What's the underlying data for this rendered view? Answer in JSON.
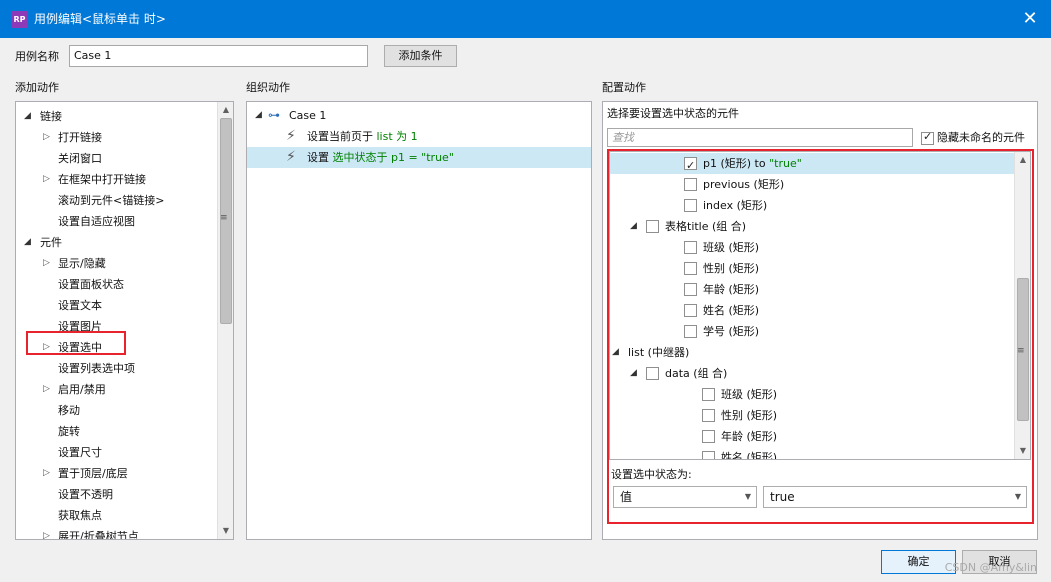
{
  "window": {
    "title": "用例编辑<鼠标单击 时>",
    "app_icon_text": "RP",
    "close_glyph": "✕"
  },
  "header": {
    "case_name_label": "用例名称",
    "case_name_value": "Case 1",
    "add_condition_button": "添加条件"
  },
  "columns": {
    "add_actions": "添加动作",
    "organize_actions": "组织动作",
    "configure_actions": "配置动作"
  },
  "actions_tree": [
    {
      "label": "链接",
      "level": 0,
      "arrow": "expanded"
    },
    {
      "label": "打开链接",
      "level": 1,
      "arrow": "collapsed"
    },
    {
      "label": "关闭窗口",
      "level": 1,
      "arrow": "none"
    },
    {
      "label": "在框架中打开链接",
      "level": 1,
      "arrow": "collapsed"
    },
    {
      "label": "滚动到元件<锚链接>",
      "level": 1,
      "arrow": "none"
    },
    {
      "label": "设置自适应视图",
      "level": 1,
      "arrow": "none"
    },
    {
      "label": "元件",
      "level": 0,
      "arrow": "expanded"
    },
    {
      "label": "显示/隐藏",
      "level": 1,
      "arrow": "collapsed"
    },
    {
      "label": "设置面板状态",
      "level": 1,
      "arrow": "none"
    },
    {
      "label": "设置文本",
      "level": 1,
      "arrow": "none"
    },
    {
      "label": "设置图片",
      "level": 1,
      "arrow": "none"
    },
    {
      "label": "设置选中",
      "level": 1,
      "arrow": "collapsed",
      "highlighted": true
    },
    {
      "label": "设置列表选中项",
      "level": 1,
      "arrow": "none"
    },
    {
      "label": "启用/禁用",
      "level": 1,
      "arrow": "collapsed"
    },
    {
      "label": "移动",
      "level": 1,
      "arrow": "none"
    },
    {
      "label": "旋转",
      "level": 1,
      "arrow": "none"
    },
    {
      "label": "设置尺寸",
      "level": 1,
      "arrow": "none"
    },
    {
      "label": "置于顶层/底层",
      "level": 1,
      "arrow": "collapsed"
    },
    {
      "label": "设置不透明",
      "level": 1,
      "arrow": "none"
    },
    {
      "label": "获取焦点",
      "level": 1,
      "arrow": "none"
    },
    {
      "label": "展开/折叠树节点",
      "level": 1,
      "arrow": "collapsed"
    }
  ],
  "organize": {
    "case_label": "Case 1",
    "actions": [
      {
        "prefix": "设置当前页于 ",
        "green": "list 为 1",
        "selected": false
      },
      {
        "prefix": "设置 ",
        "green": "选中状态于 p1 = \"true\"",
        "selected": true
      }
    ]
  },
  "configure": {
    "select_widgets_label": "选择要设置选中状态的元件",
    "search_placeholder": "查找",
    "hide_unnamed_label": "隐藏未命名的元件",
    "hide_unnamed_checked": true,
    "widgets": [
      {
        "label": "p1 (矩形) to ",
        "green": "\"true\"",
        "level": 2,
        "checked": true,
        "selected": true,
        "arrow": "none"
      },
      {
        "label": "previous (矩形)",
        "level": 2,
        "checked": false,
        "arrow": "none"
      },
      {
        "label": "index (矩形)",
        "level": 2,
        "checked": false,
        "arrow": "none"
      },
      {
        "label": "表格title (组 合)",
        "level": 1,
        "checked": false,
        "arrow": "expanded"
      },
      {
        "label": "班级 (矩形)",
        "level": 2,
        "checked": false,
        "arrow": "none"
      },
      {
        "label": "性别 (矩形)",
        "level": 2,
        "checked": false,
        "arrow": "none"
      },
      {
        "label": "年龄 (矩形)",
        "level": 2,
        "checked": false,
        "arrow": "none"
      },
      {
        "label": "姓名 (矩形)",
        "level": 2,
        "checked": false,
        "arrow": "none"
      },
      {
        "label": "学号 (矩形)",
        "level": 2,
        "checked": false,
        "arrow": "none"
      },
      {
        "label": "list (中继器)",
        "level": 0,
        "checked": null,
        "arrow": "expanded"
      },
      {
        "label": "data (组 合)",
        "level": 1,
        "checked": false,
        "arrow": "expanded"
      },
      {
        "label": "班级 (矩形)",
        "level": 3,
        "checked": false,
        "arrow": "none"
      },
      {
        "label": "性别 (矩形)",
        "level": 3,
        "checked": false,
        "arrow": "none"
      },
      {
        "label": "年龄 (矩形)",
        "level": 3,
        "checked": false,
        "arrow": "none"
      },
      {
        "label": "姓名 (矩形)",
        "level": 3,
        "checked": false,
        "arrow": "none"
      }
    ],
    "set_state_label": "设置选中状态为:",
    "value_type": "值",
    "value": "true"
  },
  "footer": {
    "ok_button": "确定",
    "cancel_button": "取消",
    "watermark": "CSDN @Amy&lin"
  },
  "colors": {
    "titlebar": "#0078d7",
    "highlight_box": "#e8232d",
    "selection": "#cce8f4",
    "green_text": "#008000"
  }
}
